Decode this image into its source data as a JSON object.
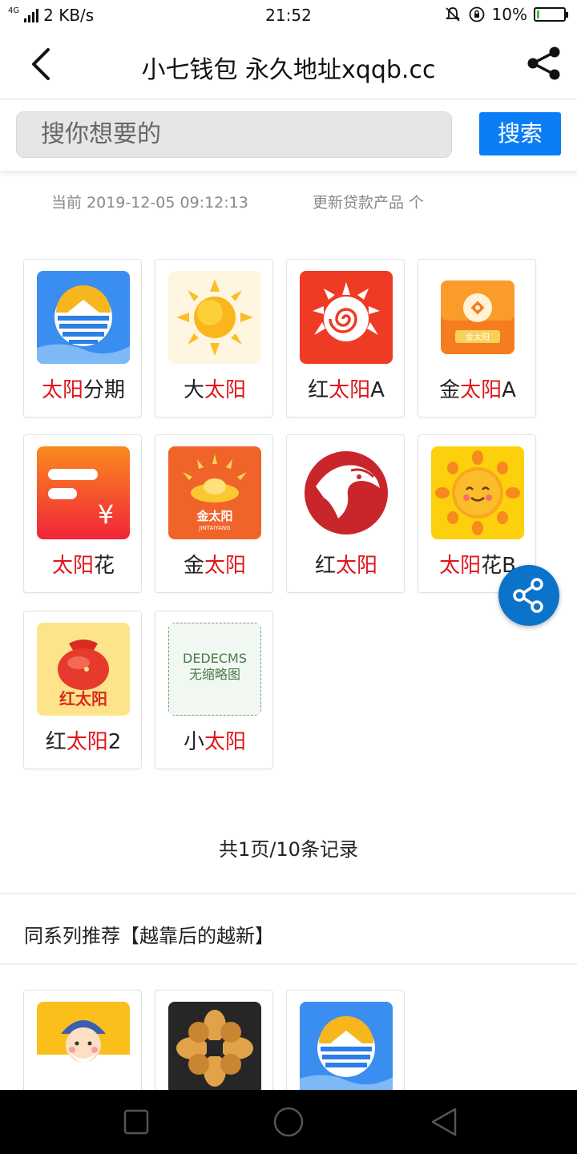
{
  "status_bar": {
    "network": "4G",
    "speed": "2 KB/s",
    "time": "21:52",
    "battery_percent": "10%",
    "battery_level": 0.1
  },
  "header": {
    "title": "小七钱包 永久地址xqqb.cc",
    "back_icon": "chevron-left-icon",
    "share_icon": "share-icon"
  },
  "search": {
    "placeholder": "搜你想要的",
    "button_label": "搜索"
  },
  "meta": {
    "current": "当前 2019-12-05 09:12:13",
    "updated": "更新贷款产品 个"
  },
  "products": [
    {
      "prefix": "",
      "highlight": "太阳",
      "suffix": "分期",
      "icon": "blue-sun-wave-logo"
    },
    {
      "prefix": "大",
      "highlight": "太阳",
      "suffix": "",
      "icon": "yellow-sun-logo"
    },
    {
      "prefix": "红",
      "highlight": "太阳",
      "suffix": "A",
      "icon": "red-spiral-sun-logo"
    },
    {
      "prefix": "金",
      "highlight": "太阳",
      "suffix": "A",
      "icon": "orange-coin-logo"
    },
    {
      "prefix": "",
      "highlight": "太阳",
      "suffix": "花",
      "icon": "red-card-yen-logo"
    },
    {
      "prefix": "金",
      "highlight": "太阳",
      "suffix": "",
      "icon": "gold-ingot-logo"
    },
    {
      "prefix": "红",
      "highlight": "太阳",
      "suffix": "",
      "icon": "red-horse-logo"
    },
    {
      "prefix": "",
      "highlight": "太阳",
      "suffix": "花B",
      "icon": "smiling-sun-logo"
    },
    {
      "prefix": "红",
      "highlight": "太阳",
      "suffix": "2",
      "icon": "red-money-bag-logo"
    },
    {
      "prefix": "小",
      "highlight": "太阳",
      "suffix": "",
      "icon": "no-thumbnail-placeholder"
    }
  ],
  "logo_text": {
    "jin_sun_small": "金太阳",
    "jin_sun_big": "金太阳",
    "jin_sun_sub": "JINTAIYANG",
    "red_sun_bag": "红太阳",
    "yen": "¥"
  },
  "placeholder": {
    "line1": "DEDECMS",
    "line2": "无缩略图"
  },
  "pager": "共1页/10条记录",
  "recommend": {
    "title": "同系列推荐【越靠后的越新】",
    "items": [
      {
        "icon": "cartoon-god-of-wealth-logo"
      },
      {
        "icon": "gold-flower-logo"
      },
      {
        "icon": "blue-sun-wave-logo"
      }
    ]
  },
  "floating_share_icon": "share-icon",
  "nav": {
    "recent": "square-icon",
    "home": "circle-icon",
    "back": "triangle-back-icon"
  },
  "colors": {
    "accent": "#0b7df5",
    "highlight": "#e0151c",
    "fab": "#0b73c9"
  }
}
